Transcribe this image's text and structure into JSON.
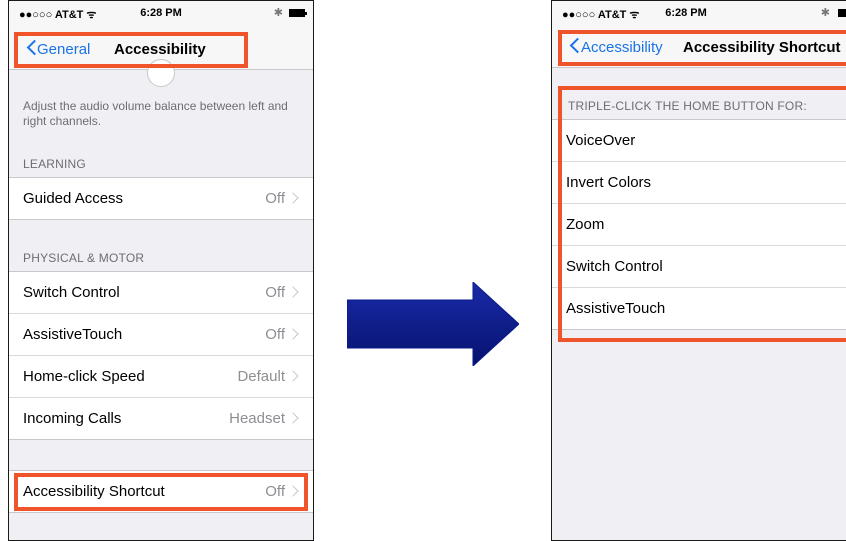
{
  "colors": {
    "ios_blue": "#1a73e8",
    "highlight": "#f0542a",
    "arrow": "#0a1a8c",
    "group_bg": "#efeff4"
  },
  "left": {
    "status": {
      "carrier": "●●○○○ AT&T ᯤ",
      "time": "6:28 PM"
    },
    "nav": {
      "back": "General",
      "title": "Accessibility"
    },
    "audio_footer": "Adjust the audio volume balance between left and right channels.",
    "learning_header": "LEARNING",
    "learning_rows": [
      {
        "label": "Guided Access",
        "value": "Off"
      }
    ],
    "physical_header": "PHYSICAL & MOTOR",
    "physical_rows": [
      {
        "label": "Switch Control",
        "value": "Off"
      },
      {
        "label": "AssistiveTouch",
        "value": "Off"
      },
      {
        "label": "Home-click Speed",
        "value": "Default"
      },
      {
        "label": "Incoming Calls",
        "value": "Headset"
      }
    ],
    "shortcut_row": {
      "label": "Accessibility Shortcut",
      "value": "Off"
    }
  },
  "right": {
    "status": {
      "carrier": "●●○○○ AT&T ᯤ",
      "time": "6:28 PM"
    },
    "nav": {
      "back": "Accessibility",
      "title": "Accessibility Shortcut"
    },
    "section_header": "TRIPLE-CLICK THE HOME BUTTON FOR:",
    "options": [
      "VoiceOver",
      "Invert Colors",
      "Zoom",
      "Switch Control",
      "AssistiveTouch"
    ]
  }
}
